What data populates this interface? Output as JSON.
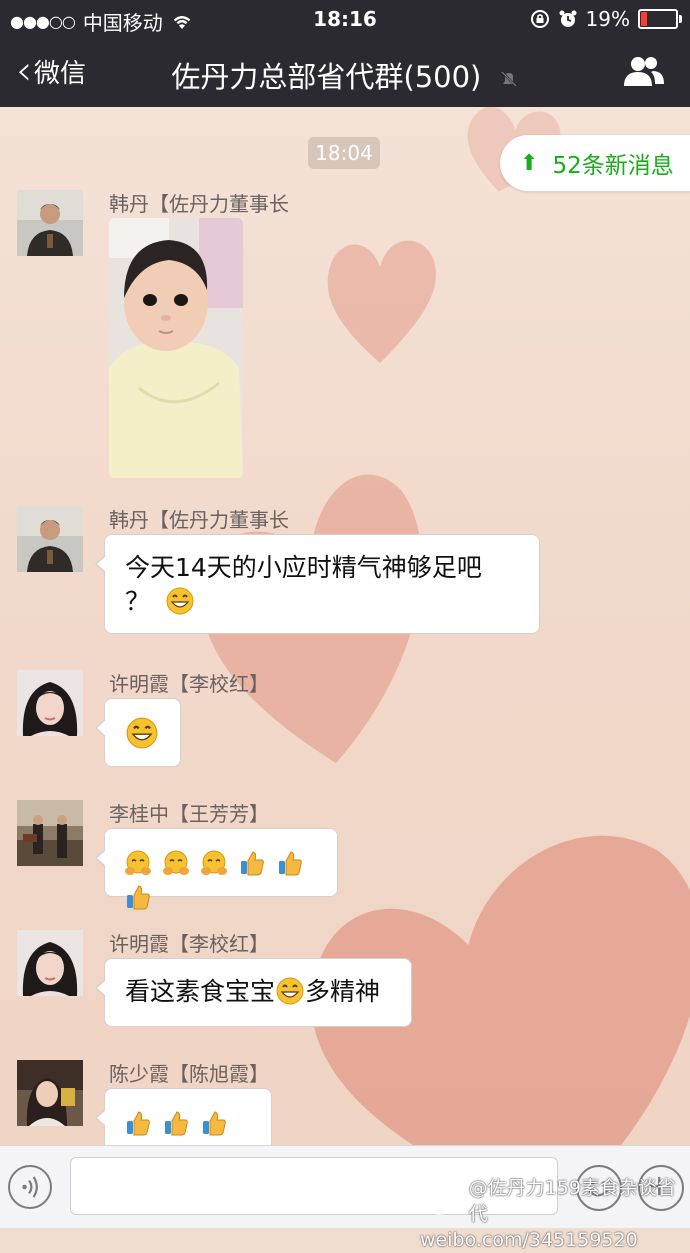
{
  "status_bar": {
    "carrier": "中国移动",
    "time": "18:16",
    "battery": "19%",
    "battery_level": 0.19
  },
  "nav": {
    "back_label": "微信",
    "title": "佐丹力总部省代群(500)"
  },
  "chat": {
    "timestamp": "18:04",
    "new_messages": "52条新消息",
    "messages": [
      {
        "sender": "韩丹【佐丹力董事长",
        "type": "image"
      },
      {
        "sender": "韩丹【佐丹力董事长",
        "line1": "今天14天的小应时精气神够足吧",
        "line2": "？"
      },
      {
        "sender": "许明霞【李校红】"
      },
      {
        "sender": "李桂中【王芳芳】"
      },
      {
        "sender": "许明霞【李校红】",
        "text_before": "看这素食宝宝",
        "text_after": "多精神"
      },
      {
        "sender": "陈少霞【陈旭霞】"
      }
    ]
  },
  "watermark": {
    "line1": "@佐丹力159素食杂谈省代",
    "line2": "weibo.com/345159520"
  },
  "colors": {
    "bar_bg": "#2b2a30",
    "green_accent": "#1aad19",
    "battery_red": "#ff3b30"
  }
}
